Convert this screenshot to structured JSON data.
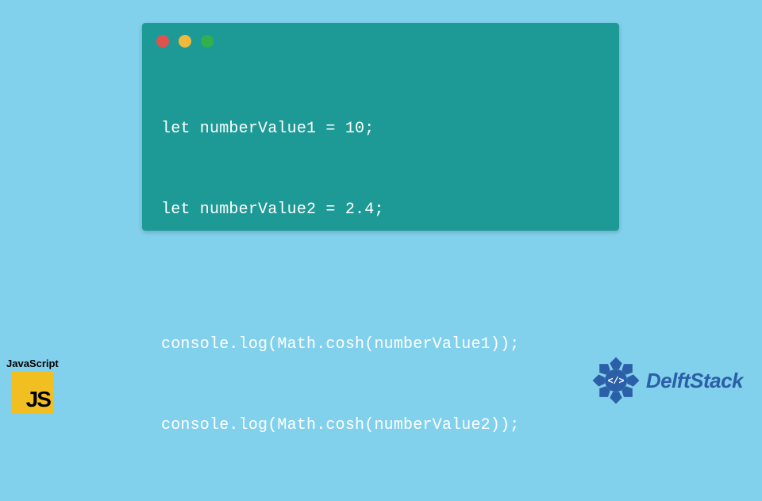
{
  "code": {
    "lines": [
      "let numberValue1 = 10;",
      "let numberValue2 = 2.4;",
      "",
      "console.log(Math.cosh(numberValue1));",
      "console.log(Math.cosh(numberValue2));"
    ]
  },
  "badges": {
    "js_label": "JavaScript",
    "js_logo_text": "JS",
    "delft_text": "DelftStack"
  },
  "colors": {
    "background": "#82d1ec",
    "code_bg": "#1e9a96",
    "js_yellow": "#f1bf22",
    "delft_blue": "#2b5fa8"
  }
}
